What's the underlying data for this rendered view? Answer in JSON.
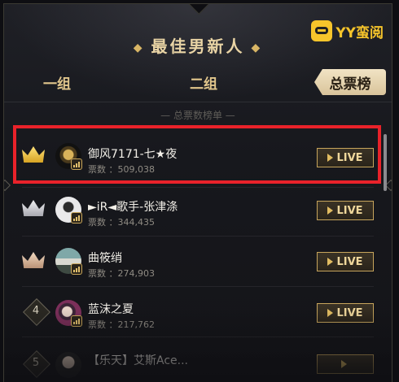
{
  "header": {
    "title": "最佳男新人",
    "brand": "YY蛮阅",
    "subheader": "— 总票数榜单 —"
  },
  "tabs": [
    {
      "label": "一组",
      "active": false
    },
    {
      "label": "二组",
      "active": false
    },
    {
      "label": "总票榜",
      "active": true
    }
  ],
  "rows": [
    {
      "rank": "1",
      "rank_style": "gold-crown",
      "name": "御风7171-七★夜",
      "votes_label": "票数",
      "votes": "509,038",
      "action": "LIVE",
      "highlighted": true
    },
    {
      "rank": "2",
      "rank_style": "silver-crown",
      "name": "►iR◄歌手-张津涤",
      "votes_label": "票数",
      "votes": "344,435",
      "action": "LIVE",
      "highlighted": false
    },
    {
      "rank": "3",
      "rank_style": "bronze-crown",
      "name": "曲筱绡",
      "votes_label": "票数",
      "votes": "274,903",
      "action": "LIVE",
      "highlighted": false
    },
    {
      "rank": "4",
      "rank_style": "number",
      "name": "蓝沫之夏",
      "votes_label": "票数",
      "votes": "217,762",
      "action": "LIVE",
      "highlighted": false
    },
    {
      "rank": "5",
      "rank_style": "number",
      "name": "【乐天】艾斯Ace...",
      "votes_label": "",
      "votes": "",
      "action": "",
      "highlighted": false
    }
  ],
  "colors": {
    "accent_gold": "#e9d4a5",
    "highlight_red": "#e9222a",
    "brand_yellow": "#f7c52b"
  }
}
